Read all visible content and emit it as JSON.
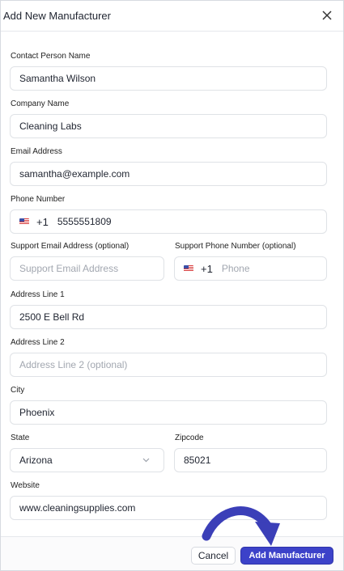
{
  "dialog": {
    "title": "Add New Manufacturer"
  },
  "fields": {
    "contact_person": {
      "label": "Contact Person Name",
      "value": "Samantha Wilson"
    },
    "company": {
      "label": "Company Name",
      "value": "Cleaning Labs"
    },
    "email": {
      "label": "Email Address",
      "value": "samantha@example.com"
    },
    "phone": {
      "label": "Phone Number",
      "country_code": "+1",
      "value": "5555551809",
      "flag_icon": "us-flag-icon"
    },
    "support_email": {
      "label": "Support Email Address (optional)",
      "placeholder": "Support Email Address"
    },
    "support_phone": {
      "label": "Support Phone Number (optional)",
      "country_code": "+1",
      "placeholder": "Phone",
      "flag_icon": "us-flag-icon"
    },
    "address1": {
      "label": "Address Line 1",
      "value": "2500 E Bell Rd"
    },
    "address2": {
      "label": "Address Line 2",
      "placeholder": "Address Line 2 (optional)"
    },
    "city": {
      "label": "City",
      "value": "Phoenix"
    },
    "state": {
      "label": "State",
      "value": "Arizona"
    },
    "zipcode": {
      "label": "Zipcode",
      "value": "85021"
    },
    "website": {
      "label": "Website",
      "value": "www.cleaningsupplies.com"
    }
  },
  "buttons": {
    "cancel": "Cancel",
    "add": "Add Manufacturer"
  },
  "colors": {
    "primary": "#3c42c9",
    "annotation_arrow": "#3b3fb8"
  }
}
